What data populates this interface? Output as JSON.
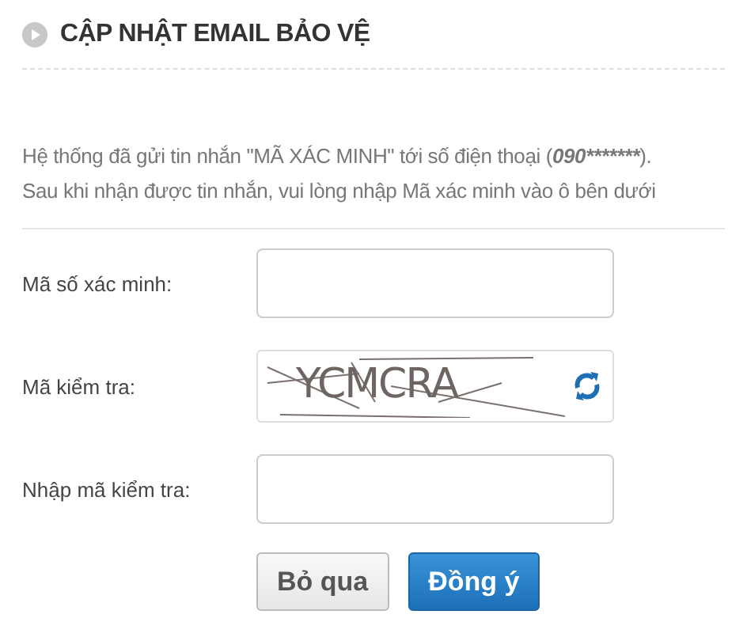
{
  "title": "CẬP NHẬT EMAIL BẢO VỆ",
  "notice": {
    "before": "Hệ thống đã gửi tin nhắn \"MÃ XÁC MINH\" tới số điện thoại (",
    "phone": "090*******",
    "after": ").",
    "second_line": "Sau khi nhận được tin nhắn, vui lòng nhập Mã xác minh vào ô bên dưới"
  },
  "fields": [
    {
      "kind": "input",
      "label": "Mã số xác minh:"
    },
    {
      "kind": "captcha",
      "label": "Mã kiểm tra:",
      "captcha": "YCMCRA"
    },
    {
      "kind": "input",
      "label": "Nhập mã kiểm tra:"
    }
  ],
  "buttons": [
    {
      "label": "Bỏ qua",
      "kind": "secondary"
    },
    {
      "label": "Đồng ý",
      "kind": "primary"
    }
  ]
}
